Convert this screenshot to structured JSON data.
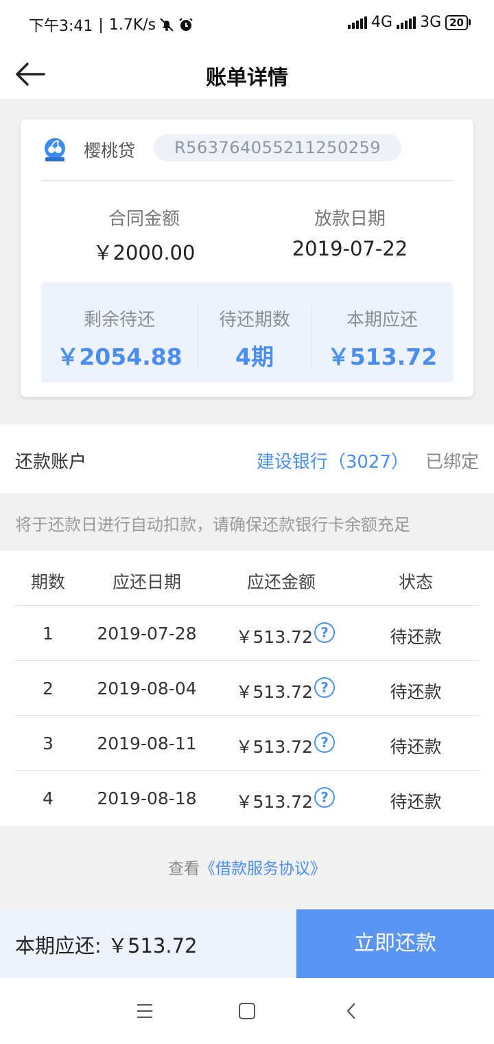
{
  "status_bar": {
    "time": "下午3:41",
    "separator": "|",
    "speed": "1.7K/s",
    "net1": "4G",
    "net2": "3G",
    "battery": "20"
  },
  "header": {
    "title": "账单详情"
  },
  "loan_card": {
    "lender": "樱桃贷",
    "contract_no": "R563764055211250259",
    "contract_amount_label": "合同金额",
    "contract_amount": "￥2000.00",
    "disbursement_date_label": "放款日期",
    "disbursement_date": "2019-07-22",
    "summary": [
      {
        "label": "剩余待还",
        "value": "￥2054.88"
      },
      {
        "label": "待还期数",
        "value": "4期"
      },
      {
        "label": "本期应还",
        "value": "￥513.72"
      }
    ]
  },
  "repay_account": {
    "label": "还款账户",
    "bank": "建设银行（3027）",
    "status": "已绑定"
  },
  "notice": "将于还款日进行自动扣款，请确保还款银行卡余额充足",
  "schedule": {
    "headers": [
      "期数",
      "应还日期",
      "应还金额",
      "状态"
    ],
    "rows": [
      {
        "period": "1",
        "date": "2019-07-28",
        "amount": "￥513.72",
        "status": "待还款"
      },
      {
        "period": "2",
        "date": "2019-08-04",
        "amount": "￥513.72",
        "status": "待还款"
      },
      {
        "period": "3",
        "date": "2019-08-11",
        "amount": "￥513.72",
        "status": "待还款"
      },
      {
        "period": "4",
        "date": "2019-08-18",
        "amount": "￥513.72",
        "status": "待还款"
      }
    ],
    "help_glyph": "?"
  },
  "agreement": {
    "prefix": "查看",
    "link": "《借款服务协议》"
  },
  "bottom_bar": {
    "due_label": "本期应还: ",
    "due_amount": "￥513.72",
    "pay_button": "立即还款"
  },
  "colors": {
    "accent": "#4a8ef0",
    "button": "#5b95f3",
    "page_bg": "#f1f1f2"
  }
}
